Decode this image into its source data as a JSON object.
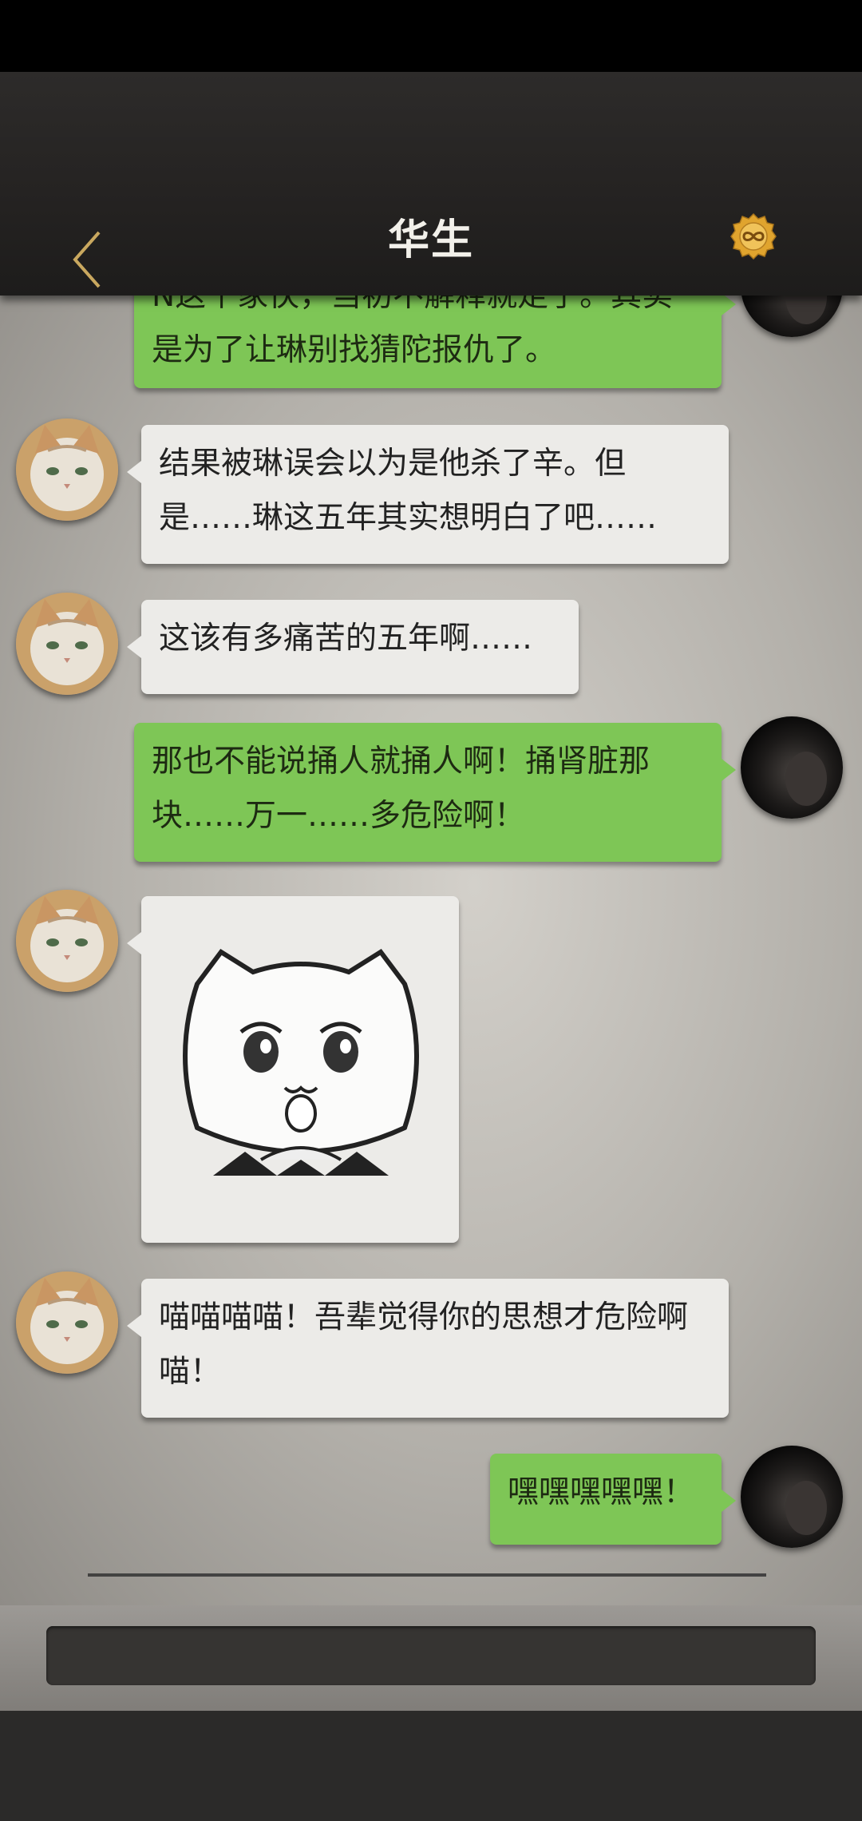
{
  "header": {
    "title": "华生",
    "back_icon": "chevron-left-icon",
    "coin_icon": "infinity-coin-icon"
  },
  "messages": [
    {
      "side": "right",
      "text": "N这个家伙，当初不解释就走了。其实是为了让琳别找猜陀报仇了。"
    },
    {
      "side": "left",
      "text": "结果被琳误会以为是他杀了辛。但是……琳这五年其实想明白了吧……"
    },
    {
      "side": "left",
      "text": "这该有多痛苦的五年啊……"
    },
    {
      "side": "right",
      "text": "那也不能说捅人就捅人啊！捅肾脏那块……万一……多危险啊！"
    },
    {
      "side": "left",
      "type": "sticker",
      "sticker": "crying-cat-sticker"
    },
    {
      "side": "left",
      "text": "喵喵喵喵！吾辈觉得你的思想才危险啊喵！"
    },
    {
      "side": "right",
      "text": "嘿嘿嘿嘿嘿！"
    }
  ],
  "colors": {
    "left_bubble": "#ecebe8",
    "right_bubble": "#7ec656",
    "header": "#242221",
    "coin": "#e0a42e"
  }
}
